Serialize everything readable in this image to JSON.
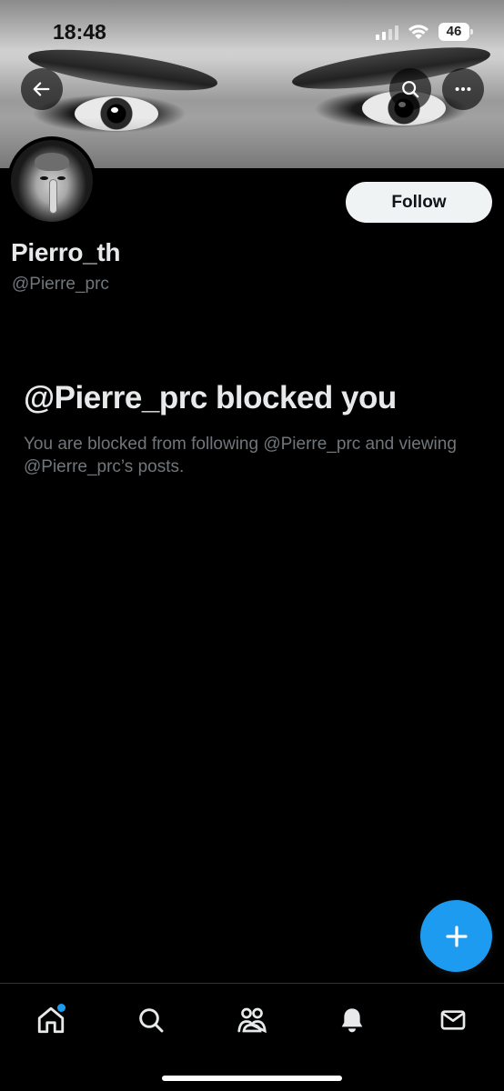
{
  "status_bar": {
    "time": "18:48",
    "battery": "46"
  },
  "header": {
    "back_icon": "arrow-left-icon",
    "search_icon": "search-icon",
    "more_icon": "more-horizontal-icon"
  },
  "profile": {
    "display_name": "Pierro_th",
    "handle": "@Pierre_prc",
    "follow_label": "Follow"
  },
  "blocked": {
    "title": "@Pierre_prc blocked you",
    "description": "You are blocked from following @Pierre_prc and viewing @Pierre_prc’s posts."
  },
  "fab": {
    "icon": "plus-icon"
  },
  "bottom_nav": {
    "items": [
      {
        "icon": "home-icon",
        "has_dot": true
      },
      {
        "icon": "search-icon"
      },
      {
        "icon": "communities-icon"
      },
      {
        "icon": "bell-icon"
      },
      {
        "icon": "mail-icon"
      }
    ]
  },
  "colors": {
    "accent": "#1d9bf0",
    "background": "#000000",
    "text_primary": "#e7e9ea",
    "text_secondary": "#71767b"
  }
}
